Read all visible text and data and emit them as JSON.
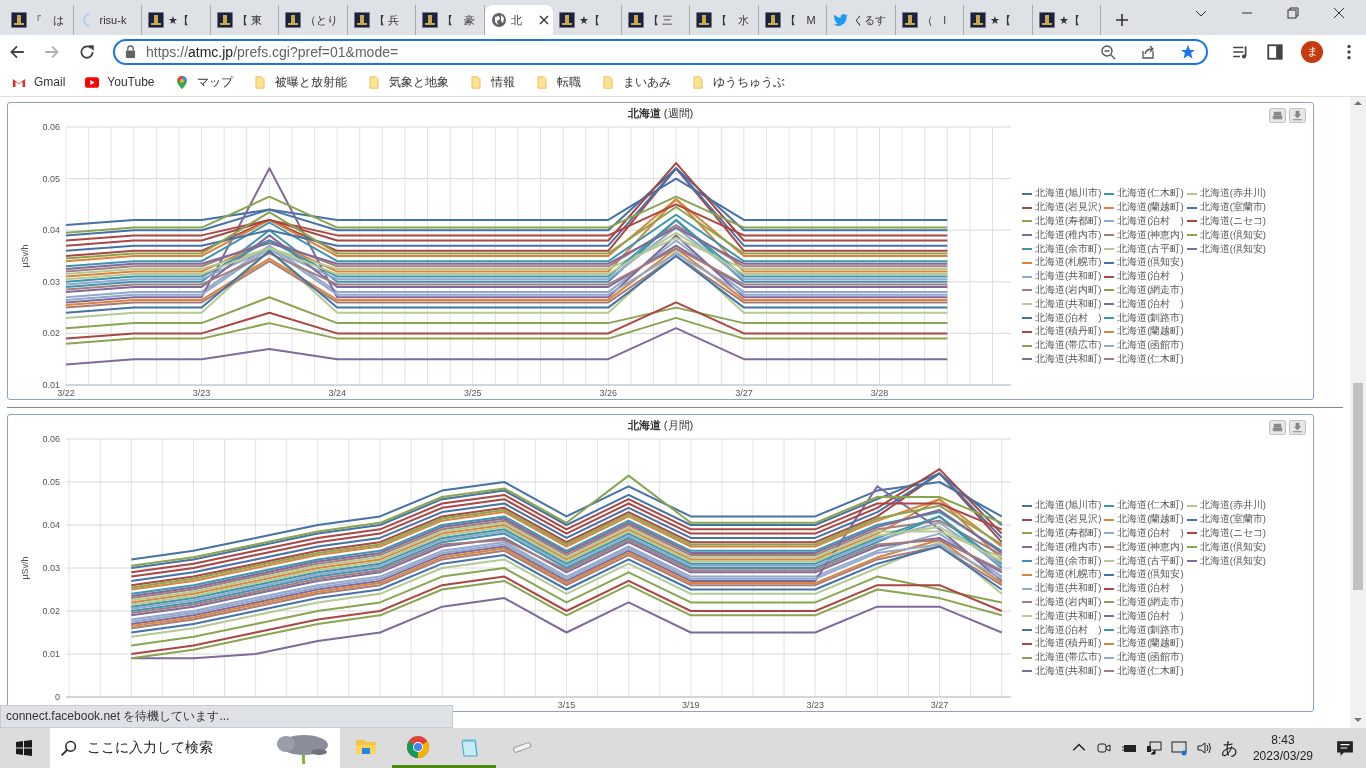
{
  "browser": {
    "tabs": [
      {
        "label": "『　は",
        "kind": "site",
        "selected": false
      },
      {
        "label": "risu-k",
        "kind": "loading",
        "selected": false
      },
      {
        "label": "★【",
        "kind": "site",
        "selected": false
      },
      {
        "label": "【 東",
        "kind": "site",
        "selected": false
      },
      {
        "label": "（とり",
        "kind": "site",
        "selected": false
      },
      {
        "label": "【 兵",
        "kind": "site",
        "selected": false
      },
      {
        "label": "【　豪",
        "kind": "site",
        "selected": false
      },
      {
        "label": "北",
        "kind": "globe",
        "selected": true
      },
      {
        "label": "★【",
        "kind": "site",
        "selected": false
      },
      {
        "label": "【 三",
        "kind": "site",
        "selected": false
      },
      {
        "label": "【　水",
        "kind": "site",
        "selected": false
      },
      {
        "label": "【　M",
        "kind": "site",
        "selected": false
      },
      {
        "label": "くるす",
        "kind": "twitter",
        "selected": false
      },
      {
        "label": "（　l",
        "kind": "site",
        "selected": false
      },
      {
        "label": "★【",
        "kind": "site",
        "selected": false
      },
      {
        "label": "★【",
        "kind": "site",
        "selected": false
      }
    ],
    "url": {
      "scheme": "https://",
      "host": "atmc.jp",
      "path": "/prefs.cgi?pref=01&mode="
    },
    "profile": "ま",
    "bookmarks": [
      {
        "label": "Gmail",
        "kind": "gmail"
      },
      {
        "label": "YouTube",
        "kind": "youtube"
      },
      {
        "label": "マップ",
        "kind": "maps"
      },
      {
        "label": "被曝と放射能",
        "kind": "folder"
      },
      {
        "label": "気象と地象",
        "kind": "folder"
      },
      {
        "label": "情報",
        "kind": "folder"
      },
      {
        "label": "転職",
        "kind": "folder"
      },
      {
        "label": "まいあみ",
        "kind": "folder"
      },
      {
        "label": "ゆうちゅうぶ",
        "kind": "folder"
      }
    ]
  },
  "charts": [
    {
      "chart_data": {
        "type": "line",
        "title": "**北海道** (週間)",
        "ylabel": "µSv/h",
        "ylim": [
          0.01,
          0.06
        ],
        "grid": true,
        "legend": "right",
        "categories": [
          "3/22",
          null,
          "3/23",
          null,
          "3/24",
          null,
          "3/25",
          null,
          "3/26",
          null,
          "3/27",
          null,
          "3/28",
          null
        ],
        "yticks": [
          0.01,
          0.02,
          0.03,
          0.04,
          0.05,
          0.06
        ],
        "series": [
          {
            "name": "北海道(旭川市)",
            "color": "#4572a7",
            "values": [
              0.039,
              0.04,
              0.04,
              0.044,
              0.04,
              0.04,
              0.04,
              0.04,
              0.04,
              0.052,
              0.04,
              0.04,
              0.04,
              0.04
            ]
          },
          {
            "name": "北海道(岩見沢)",
            "color": "#aa4643",
            "values": [
              0.035,
              0.036,
              0.036,
              0.042,
              0.036,
              0.036,
              0.036,
              0.036,
              0.036,
              0.052,
              0.036,
              0.036,
              0.036,
              0.036
            ]
          },
          {
            "name": "北海道(寿都町)",
            "color": "#89a54e",
            "values": [
              0.021,
              0.022,
              0.022,
              0.027,
              0.022,
              0.022,
              0.022,
              0.022,
              0.022,
              0.025,
              0.022,
              0.022,
              0.022,
              0.022
            ]
          },
          {
            "name": "北海道(稚内市)",
            "color": "#80699b",
            "values": [
              0.014,
              0.015,
              0.015,
              0.017,
              0.015,
              0.015,
              0.015,
              0.015,
              0.015,
              0.021,
              0.015,
              0.015,
              0.015,
              0.015
            ]
          },
          {
            "name": "北海道(余市町)",
            "color": "#3d96ae",
            "values": [
              0.029,
              0.03,
              0.03,
              0.04,
              0.03,
              0.03,
              0.03,
              0.03,
              0.03,
              0.042,
              0.03,
              0.03,
              0.03,
              0.03
            ]
          },
          {
            "name": "北海道(札幌市)",
            "color": "#db843d",
            "values": [
              0.031,
              0.032,
              0.032,
              0.038,
              0.032,
              0.032,
              0.032,
              0.032,
              0.032,
              0.046,
              0.032,
              0.032,
              0.032,
              0.032
            ]
          },
          {
            "name": "北海道(共和町)",
            "color": "#92a8cd",
            "values": [
              0.027,
              0.028,
              0.028,
              0.037,
              0.028,
              0.028,
              0.028,
              0.028,
              0.028,
              0.038,
              0.028,
              0.028,
              0.028,
              0.028
            ]
          },
          {
            "name": "北海道(岩内町)",
            "color": "#a47d7c",
            "values": [
              0.032,
              0.033,
              0.033,
              0.038,
              0.033,
              0.033,
              0.033,
              0.033,
              0.033,
              0.041,
              0.033,
              0.033,
              0.033,
              0.033
            ]
          },
          {
            "name": "北海道(共和町)",
            "color": "#b5ca92",
            "values": [
              0.023,
              0.024,
              0.024,
              0.036,
              0.024,
              0.024,
              0.024,
              0.024,
              0.024,
              0.036,
              0.024,
              0.024,
              0.024,
              0.024
            ]
          },
          {
            "name": "北海道(泊村　)",
            "color": "#4572a7",
            "values": [
              0.041,
              0.042,
              0.042,
              0.044,
              0.042,
              0.042,
              0.042,
              0.042,
              0.042,
              0.05,
              0.042,
              0.042,
              0.042,
              0.042
            ]
          },
          {
            "name": "北海道(積丹町)",
            "color": "#aa4643",
            "values": [
              0.019,
              0.02,
              0.02,
              0.024,
              0.02,
              0.02,
              0.02,
              0.02,
              0.02,
              0.026,
              0.02,
              0.02,
              0.02,
              0.02
            ]
          },
          {
            "name": "北海道(帯広市)",
            "color": "#89a54e",
            "values": [
              0.018,
              0.019,
              0.019,
              0.022,
              0.019,
              0.019,
              0.019,
              0.019,
              0.019,
              0.023,
              0.019,
              0.019,
              0.019,
              0.019
            ]
          },
          {
            "name": "北海道(共和町)",
            "color": "#80699b",
            "values": [
              0.026,
              0.027,
              0.027,
              0.052,
              0.027,
              0.027,
              0.027,
              0.027,
              0.027,
              0.039,
              0.027,
              0.027,
              0.027,
              0.027
            ]
          },
          {
            "name": "北海道(仁木町)",
            "color": "#3d96ae",
            "values": [
              0.033,
              0.034,
              0.034,
              0.0415,
              0.034,
              0.034,
              0.034,
              0.034,
              0.034,
              0.043,
              0.034,
              0.034,
              0.034,
              0.034
            ]
          },
          {
            "name": "北海道(蘭越町)",
            "color": "#db843d",
            "values": [
              0.034,
              0.035,
              0.035,
              0.042,
              0.035,
              0.035,
              0.035,
              0.035,
              0.035,
              0.046,
              0.035,
              0.035,
              0.035,
              0.035
            ]
          },
          {
            "name": "北海道(泊村　)",
            "color": "#92a8cd",
            "values": [
              0.0295,
              0.0305,
              0.0305,
              0.0365,
              0.0305,
              0.0305,
              0.0305,
              0.0305,
              0.0305,
              0.0405,
              0.0305,
              0.0305,
              0.0305,
              0.0305
            ]
          },
          {
            "name": "北海道(神恵内)",
            "color": "#a47d7c",
            "values": [
              0.025,
              0.026,
              0.026,
              0.034,
              0.026,
              0.026,
              0.026,
              0.026,
              0.026,
              0.035,
              0.026,
              0.026,
              0.026,
              0.026
            ]
          },
          {
            "name": "北海道(古平町)",
            "color": "#b5ca92",
            "values": [
              0.0315,
              0.0325,
              0.0325,
              0.0365,
              0.0325,
              0.0325,
              0.0325,
              0.0325,
              0.0325,
              0.0385,
              0.0325,
              0.0325,
              0.0325,
              0.0325
            ]
          },
          {
            "name": "北海道(倶知安)",
            "color": "#4572a7",
            "values": [
              0.036,
              0.037,
              0.037,
              0.04,
              0.037,
              0.037,
              0.037,
              0.037,
              0.037,
              0.052,
              0.037,
              0.037,
              0.037,
              0.037
            ]
          },
          {
            "name": "北海道(泊村　)",
            "color": "#aa4643",
            "values": [
              0.037,
              0.038,
              0.038,
              0.042,
              0.038,
              0.038,
              0.038,
              0.038,
              0.038,
              0.053,
              0.038,
              0.038,
              0.038,
              0.038
            ]
          },
          {
            "name": "北海道(網走市)",
            "color": "#89a54e",
            "values": [
              0.0395,
              0.0405,
              0.0405,
              0.0465,
              0.0405,
              0.0405,
              0.0405,
              0.0405,
              0.0405,
              0.0465,
              0.0405,
              0.0405,
              0.0405,
              0.0405
            ]
          },
          {
            "name": "北海道(泊村　)",
            "color": "#80699b",
            "values": [
              0.028,
              0.029,
              0.029,
              0.039,
              0.029,
              0.029,
              0.029,
              0.029,
              0.029,
              0.037,
              0.029,
              0.029,
              0.029,
              0.029
            ]
          },
          {
            "name": "北海道(釧路市)",
            "color": "#3d96ae",
            "values": [
              0.03,
              0.031,
              0.031,
              0.038,
              0.031,
              0.031,
              0.031,
              0.031,
              0.031,
              0.042,
              0.031,
              0.031,
              0.031,
              0.031
            ]
          },
          {
            "name": "北海道(蘭越町)",
            "color": "#db843d",
            "values": [
              0.0255,
              0.0265,
              0.0265,
              0.0345,
              0.0265,
              0.0265,
              0.0265,
              0.0265,
              0.0265,
              0.0365,
              0.0265,
              0.0265,
              0.0265,
              0.0265
            ]
          },
          {
            "name": "北海道(函館市)",
            "color": "#92a8cd",
            "values": [
              0.0265,
              0.0275,
              0.0275,
              0.0365,
              0.0275,
              0.0275,
              0.0275,
              0.0275,
              0.0275,
              0.0355,
              0.0275,
              0.0275,
              0.0275,
              0.0275
            ]
          },
          {
            "name": "北海道(仁木町)",
            "color": "#a47d7c",
            "values": [
              0.0285,
              0.0295,
              0.0295,
              0.0355,
              0.0295,
              0.0295,
              0.0295,
              0.0295,
              0.0295,
              0.0365,
              0.0295,
              0.0295,
              0.0295,
              0.0295
            ]
          },
          {
            "name": "北海道(赤井川)",
            "color": "#b5ca92",
            "values": [
              0.0305,
              0.0315,
              0.0315,
              0.0365,
              0.0315,
              0.0315,
              0.0315,
              0.0315,
              0.0315,
              0.0395,
              0.0315,
              0.0315,
              0.0315,
              0.0315
            ]
          },
          {
            "name": "北海道(室蘭市)",
            "color": "#4572a7",
            "values": [
              0.024,
              0.025,
              0.025,
              0.036,
              0.025,
              0.025,
              0.025,
              0.025,
              0.025,
              0.035,
              0.025,
              0.025,
              0.025,
              0.025
            ]
          },
          {
            "name": "北海道(ニセコ)",
            "color": "#aa4643",
            "values": [
              0.038,
              0.039,
              0.039,
              0.042,
              0.039,
              0.039,
              0.039,
              0.039,
              0.039,
              0.045,
              0.039,
              0.039,
              0.039,
              0.039
            ]
          },
          {
            "name": "北海道(倶知安)",
            "color": "#89a54e",
            "values": [
              0.0345,
              0.0355,
              0.0355,
              0.0435,
              0.0355,
              0.0355,
              0.0355,
              0.0355,
              0.0355,
              0.0445,
              0.0355,
              0.0355,
              0.0355,
              0.0355
            ]
          },
          {
            "name": "北海道(倶知安)",
            "color": "#80699b",
            "values": [
              0.0325,
              0.0335,
              0.0335,
              0.0375,
              0.0335,
              0.0335,
              0.0335,
              0.0335,
              0.0335,
              0.0405,
              0.0335,
              0.0335,
              0.0335,
              0.0335
            ]
          }
        ]
      }
    },
    {
      "chart_data": {
        "type": "line",
        "title": "**北海道** (月間)",
        "ylabel": "µSv/h",
        "ylim": [
          0,
          0.06
        ],
        "grid": true,
        "legend": "right",
        "categories": [
          null,
          null,
          null,
          null,
          null,
          null,
          null,
          "3/15",
          null,
          "3/19",
          null,
          "3/23",
          null,
          "3/27",
          null
        ],
        "yticks": [
          0,
          0.01,
          0.02,
          0.03,
          0.04,
          0.05,
          0.06
        ],
        "series": [
          {
            "name": "北海道(旭川市)",
            "color": "#4572a7",
            "values": [
              0.03,
              0.032,
              0.035,
              0.038,
              0.04,
              0.046,
              0.048,
              0.04,
              0.047,
              0.04,
              0.04,
              0.04,
              0.046,
              0.052,
              0.04
            ]
          },
          {
            "name": "北海道(岩見沢)",
            "color": "#aa4643",
            "values": [
              0.026,
              0.028,
              0.031,
              0.034,
              0.036,
              0.042,
              0.044,
              0.036,
              0.043,
              0.036,
              0.036,
              0.036,
              0.042,
              0.052,
              0.036
            ]
          },
          {
            "name": "北海道(寿都町)",
            "color": "#89a54e",
            "values": [
              0.012,
              0.014,
              0.017,
              0.02,
              0.022,
              0.028,
              0.03,
              0.022,
              0.029,
              0.022,
              0.022,
              0.022,
              0.028,
              0.025,
              0.022
            ]
          },
          {
            "name": "北海道(稚内市)",
            "color": "#80699b",
            "values": [
              0.009,
              0.009,
              0.01,
              0.013,
              0.015,
              0.021,
              0.023,
              0.015,
              0.022,
              0.015,
              0.015,
              0.015,
              0.021,
              0.021,
              0.015
            ]
          },
          {
            "name": "北海道(余市町)",
            "color": "#3d96ae",
            "values": [
              0.02,
              0.022,
              0.025,
              0.028,
              0.03,
              0.036,
              0.038,
              0.03,
              0.037,
              0.03,
              0.03,
              0.03,
              0.036,
              0.042,
              0.03
            ]
          },
          {
            "name": "北海道(札幌市)",
            "color": "#db843d",
            "values": [
              0.022,
              0.024,
              0.027,
              0.03,
              0.032,
              0.038,
              0.04,
              0.032,
              0.039,
              0.032,
              0.032,
              0.032,
              0.038,
              0.046,
              0.032
            ]
          },
          {
            "name": "北海道(共和町)",
            "color": "#92a8cd",
            "values": [
              0.018,
              0.02,
              0.023,
              0.026,
              0.028,
              0.034,
              0.036,
              0.028,
              0.035,
              0.028,
              0.028,
              0.028,
              0.034,
              0.038,
              0.028
            ]
          },
          {
            "name": "北海道(岩内町)",
            "color": "#a47d7c",
            "values": [
              0.023,
              0.025,
              0.028,
              0.031,
              0.033,
              0.039,
              0.041,
              0.033,
              0.04,
              0.033,
              0.033,
              0.033,
              0.039,
              0.041,
              0.033
            ]
          },
          {
            "name": "北海道(共和町)",
            "color": "#b5ca92",
            "values": [
              0.014,
              0.016,
              0.019,
              0.022,
              0.024,
              0.03,
              0.032,
              0.024,
              0.031,
              0.024,
              0.024,
              0.024,
              0.03,
              0.036,
              0.024
            ]
          },
          {
            "name": "北海道(泊村　)",
            "color": "#4572a7",
            "values": [
              0.032,
              0.034,
              0.037,
              0.04,
              0.042,
              0.048,
              0.05,
              0.042,
              0.049,
              0.042,
              0.042,
              0.042,
              0.048,
              0.05,
              0.042
            ]
          },
          {
            "name": "北海道(積丹町)",
            "color": "#aa4643",
            "values": [
              0.01,
              0.012,
              0.015,
              0.018,
              0.02,
              0.026,
              0.028,
              0.02,
              0.027,
              0.02,
              0.02,
              0.02,
              0.026,
              0.026,
              0.02
            ]
          },
          {
            "name": "北海道(帯広市)",
            "color": "#89a54e",
            "values": [
              0.009,
              0.011,
              0.014,
              0.017,
              0.019,
              0.025,
              0.027,
              0.019,
              0.026,
              0.019,
              0.019,
              0.019,
              0.025,
              0.023,
              0.019
            ]
          },
          {
            "name": "北海道(共和町)",
            "color": "#80699b",
            "values": [
              0.017,
              0.019,
              0.022,
              0.025,
              0.027,
              0.033,
              0.035,
              0.027,
              0.034,
              0.027,
              0.027,
              0.027,
              0.049,
              0.039,
              0.027
            ]
          },
          {
            "name": "北海道(仁木町)",
            "color": "#3d96ae",
            "values": [
              0.024,
              0.026,
              0.029,
              0.032,
              0.034,
              0.04,
              0.042,
              0.034,
              0.041,
              0.034,
              0.034,
              0.034,
              0.04,
              0.043,
              0.034
            ]
          },
          {
            "name": "北海道(蘭越町)",
            "color": "#db843d",
            "values": [
              0.025,
              0.027,
              0.03,
              0.033,
              0.035,
              0.041,
              0.043,
              0.035,
              0.042,
              0.035,
              0.035,
              0.035,
              0.041,
              0.046,
              0.035
            ]
          },
          {
            "name": "北海道(泊村　)",
            "color": "#92a8cd",
            "values": [
              0.0205,
              0.0225,
              0.0255,
              0.0285,
              0.0305,
              0.0365,
              0.0385,
              0.0305,
              0.0375,
              0.0305,
              0.0305,
              0.0305,
              0.0365,
              0.0405,
              0.0305
            ]
          },
          {
            "name": "北海道(神恵内)",
            "color": "#a47d7c",
            "values": [
              0.016,
              0.018,
              0.021,
              0.024,
              0.026,
              0.032,
              0.034,
              0.026,
              0.033,
              0.026,
              0.026,
              0.026,
              0.032,
              0.035,
              0.026
            ]
          },
          {
            "name": "北海道(古平町)",
            "color": "#b5ca92",
            "values": [
              0.0225,
              0.0245,
              0.0275,
              0.0305,
              0.0325,
              0.0385,
              0.0405,
              0.0325,
              0.0395,
              0.0325,
              0.0325,
              0.0325,
              0.0385,
              0.0385,
              0.0325
            ]
          },
          {
            "name": "北海道(倶知安)",
            "color": "#4572a7",
            "values": [
              0.027,
              0.029,
              0.032,
              0.035,
              0.037,
              0.043,
              0.045,
              0.037,
              0.044,
              0.037,
              0.037,
              0.037,
              0.043,
              0.052,
              0.037
            ]
          },
          {
            "name": "北海道(泊村　)",
            "color": "#aa4643",
            "values": [
              0.028,
              0.03,
              0.033,
              0.036,
              0.038,
              0.044,
              0.046,
              0.038,
              0.045,
              0.038,
              0.038,
              0.038,
              0.044,
              0.053,
              0.038
            ]
          },
          {
            "name": "北海道(網走市)",
            "color": "#89a54e",
            "values": [
              0.0305,
              0.0325,
              0.0355,
              0.0385,
              0.0405,
              0.0465,
              0.0485,
              0.0405,
              0.0515,
              0.0405,
              0.0405,
              0.0405,
              0.0465,
              0.0465,
              0.0405
            ]
          },
          {
            "name": "北海道(泊村　)",
            "color": "#80699b",
            "values": [
              0.019,
              0.021,
              0.024,
              0.027,
              0.029,
              0.035,
              0.037,
              0.029,
              0.036,
              0.029,
              0.029,
              0.029,
              0.035,
              0.037,
              0.029
            ]
          },
          {
            "name": "北海道(釧路市)",
            "color": "#3d96ae",
            "values": [
              0.021,
              0.023,
              0.026,
              0.029,
              0.031,
              0.037,
              0.039,
              0.031,
              0.038,
              0.031,
              0.031,
              0.031,
              0.037,
              0.042,
              0.031
            ]
          },
          {
            "name": "北海道(蘭越町)",
            "color": "#db843d",
            "values": [
              0.0165,
              0.0185,
              0.0215,
              0.0245,
              0.0265,
              0.0325,
              0.0345,
              0.0265,
              0.0335,
              0.0265,
              0.0265,
              0.0265,
              0.0325,
              0.0365,
              0.0265
            ]
          },
          {
            "name": "北海道(函館市)",
            "color": "#92a8cd",
            "values": [
              0.0175,
              0.0195,
              0.0225,
              0.0255,
              0.0275,
              0.0335,
              0.0355,
              0.0275,
              0.0345,
              0.0275,
              0.0275,
              0.0275,
              0.0335,
              0.0355,
              0.0275
            ]
          },
          {
            "name": "北海道(仁木町)",
            "color": "#a47d7c",
            "values": [
              0.0195,
              0.0215,
              0.0245,
              0.0275,
              0.0295,
              0.0355,
              0.0365,
              0.0295,
              0.0365,
              0.0295,
              0.0295,
              0.0295,
              0.0355,
              0.0365,
              0.0295
            ]
          },
          {
            "name": "北海道(赤井川)",
            "color": "#b5ca92",
            "values": [
              0.0215,
              0.0235,
              0.0265,
              0.0295,
              0.0315,
              0.0375,
              0.0395,
              0.0315,
              0.0385,
              0.0315,
              0.0315,
              0.0315,
              0.0375,
              0.0395,
              0.0315
            ]
          },
          {
            "name": "北海道(室蘭市)",
            "color": "#4572a7",
            "values": [
              0.015,
              0.017,
              0.02,
              0.023,
              0.025,
              0.031,
              0.033,
              0.025,
              0.032,
              0.025,
              0.025,
              0.025,
              0.031,
              0.035,
              0.025
            ]
          },
          {
            "name": "北海道(ニセコ)",
            "color": "#aa4643",
            "values": [
              0.029,
              0.031,
              0.034,
              0.037,
              0.039,
              0.045,
              0.047,
              0.039,
              0.046,
              0.039,
              0.039,
              0.039,
              0.045,
              0.045,
              0.039
            ]
          },
          {
            "name": "北海道(倶知安)",
            "color": "#89a54e",
            "values": [
              0.0255,
              0.0275,
              0.0305,
              0.0335,
              0.0355,
              0.0415,
              0.0435,
              0.0355,
              0.0425,
              0.0355,
              0.0355,
              0.0355,
              0.0415,
              0.0445,
              0.0355
            ]
          },
          {
            "name": "北海道(倶知安)",
            "color": "#80699b",
            "values": [
              0.0235,
              0.0255,
              0.0285,
              0.0315,
              0.0335,
              0.0395,
              0.0415,
              0.0335,
              0.0405,
              0.0335,
              0.0335,
              0.0335,
              0.0395,
              0.0435,
              0.0335
            ]
          }
        ]
      }
    }
  ],
  "status_bar": "connect.facebook.net を待機しています...",
  "taskbar": {
    "search_placeholder": "ここに入力して検索",
    "apps": [
      {
        "kind": "explorer",
        "running": false
      },
      {
        "kind": "chrome",
        "running": true
      },
      {
        "kind": "notepad",
        "running": true
      },
      {
        "kind": "usb",
        "running": false
      }
    ],
    "ime": "あ",
    "time": "8:43",
    "date": "2023/03/29"
  }
}
